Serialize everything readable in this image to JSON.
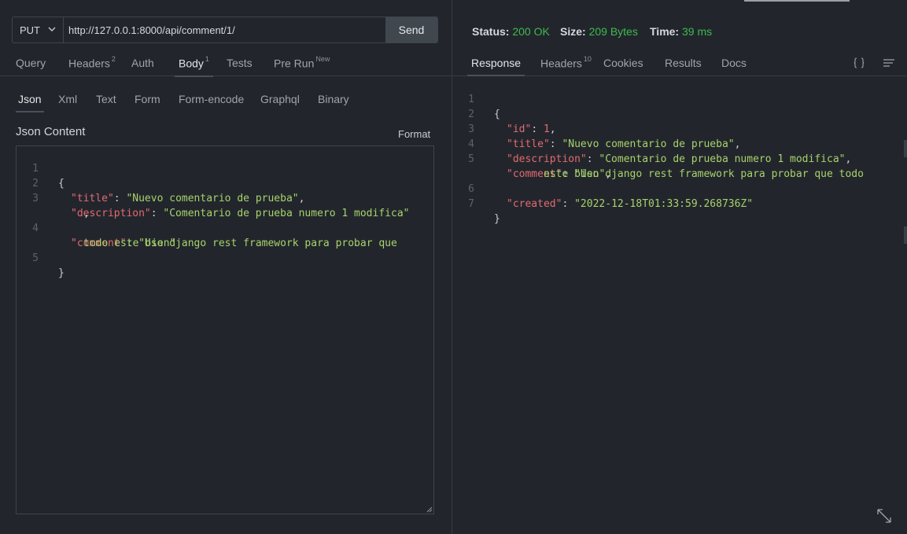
{
  "request": {
    "method": "PUT",
    "url": "http://127.0.0.1:8000/api/comment/1/",
    "send_label": "Send"
  },
  "request_tabs": [
    {
      "label": "Query",
      "badge": ""
    },
    {
      "label": "Headers",
      "badge": "2"
    },
    {
      "label": "Auth",
      "badge": ""
    },
    {
      "label": "Body",
      "badge": "1"
    },
    {
      "label": "Tests",
      "badge": ""
    },
    {
      "label": "Pre Run",
      "badge": "New"
    }
  ],
  "body_tabs": [
    "Json",
    "Xml",
    "Text",
    "Form",
    "Form-encode",
    "Graphql",
    "Binary"
  ],
  "json_content_label": "Json Content",
  "format_label": "Format",
  "request_body": {
    "line_numbers": [
      "1",
      "2",
      "3",
      "4",
      "5"
    ],
    "open_brace": "{",
    "close_brace": "}",
    "title_key": "\"title\"",
    "title_value": "\"Nuevo comentario de prueba\"",
    "description_key": "\"description\"",
    "description_value": "\"Comentario de prueba numero 1 modifica\"",
    "comment_key": "\"comment\"",
    "comment_value_1": "\"Uso django rest framework para probar que",
    "comment_value_2": "todo este bien\""
  },
  "response_status": {
    "status_label": "Status:",
    "status_value": "200 OK",
    "size_label": "Size:",
    "size_value": "209 Bytes",
    "time_label": "Time:",
    "time_value": "39 ms"
  },
  "response_tabs": [
    {
      "label": "Response",
      "badge": ""
    },
    {
      "label": "Headers",
      "badge": "10"
    },
    {
      "label": "Cookies",
      "badge": ""
    },
    {
      "label": "Results",
      "badge": ""
    },
    {
      "label": "Docs",
      "badge": ""
    }
  ],
  "response_body": {
    "line_numbers": [
      "1",
      "2",
      "3",
      "4",
      "5",
      "6",
      "7"
    ],
    "open_brace": "{",
    "close_brace": "}",
    "id_key": "\"id\"",
    "id_value": "1",
    "title_key": "\"title\"",
    "title_value": "\"Nuevo comentario de prueba\"",
    "description_key": "\"description\"",
    "description_value": "\"Comentario de prueba numero 1 modifica\"",
    "comment_key": "\"comment\"",
    "comment_value_1": "\"Uso django rest framework para probar que todo",
    "comment_value_2": "este bien\"",
    "created_key": "\"created\"",
    "created_value": "\"2022-12-18T01:33:59.268736Z\""
  },
  "icons": {
    "method_dropdown": "chevron-down-icon",
    "braces": "braces-icon",
    "wrap": "text-wrap-icon",
    "expand": "expand-icon",
    "resize": "resize-handle-icon"
  },
  "colors": {
    "status_ok": "#3fb950",
    "json_key": "#e26a70",
    "json_string": "#a8d26c",
    "background": "#22262c"
  }
}
